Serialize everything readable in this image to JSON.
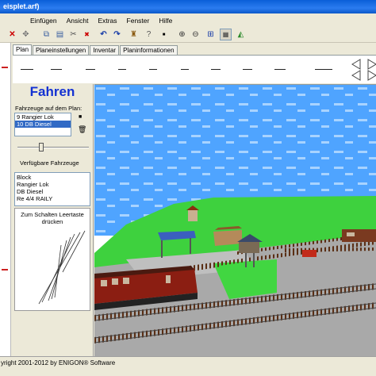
{
  "window": {
    "title": "eisplet.arf)"
  },
  "menu": {
    "items": [
      "Einfügen",
      "Ansicht",
      "Extras",
      "Fenster",
      "Hilfe"
    ]
  },
  "tabs": [
    "Plan",
    "Planeinstellungen",
    "Inventar",
    "Planinformationen"
  ],
  "left_panel": {
    "heading": "Fahren",
    "vehicles_on_plan_label": "Fahrzeuge auf dem Plan:",
    "vehicles_on_plan": [
      {
        "label": "9   Rangier Lok",
        "selected": false
      },
      {
        "label": "10  DB Diesel",
        "selected": true
      }
    ],
    "available_label": "Verfügbare Fahrzeuge",
    "available_vehicles": [
      "Block",
      "Rangier Lok",
      "DB Diesel",
      "Re 4/4 RAILY"
    ],
    "switch_hint_line1": "Zum Schalten Leertaste",
    "switch_hint_line2": "drücken"
  },
  "status": {
    "text": "yright 2001-2012 by ENIGON® Software"
  },
  "colors": {
    "accent_blue": "#1432d2",
    "selection": "#316ac5",
    "sky": "#4fa4ff",
    "grass": "#3ed13e"
  },
  "icons": [
    "stop-icon",
    "move-icon",
    "copy-icon",
    "paste-icon",
    "cut-icon",
    "undo-icon",
    "redo-icon",
    "figure-icon",
    "info-icon",
    "record-icon",
    "zoom-in-icon",
    "zoom-out-icon",
    "fit-icon",
    "grid-icon",
    "view-icon"
  ]
}
